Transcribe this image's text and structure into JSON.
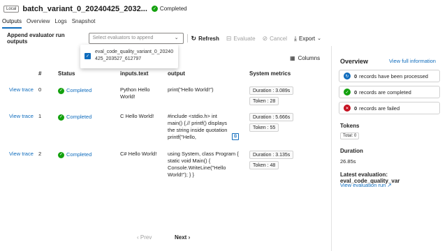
{
  "header": {
    "badge": "Local",
    "title": "batch_variant_0_20240425_2032...",
    "status": "Completed"
  },
  "tabs": [
    "Outputs",
    "Overview",
    "Logs",
    "Snapshot"
  ],
  "toolbar": {
    "append_label": "Append evaluator run outputs",
    "select_placeholder": "Select evaluators to append",
    "refresh": "Refresh",
    "evaluate": "Evaluate",
    "cancel": "Cancel",
    "export": "Export"
  },
  "dropdown": {
    "option": "eval_code_quality_variant_0_20240425_203527_612797"
  },
  "table": {
    "columns_button": "Columns",
    "headers": [
      "#",
      "Status",
      "inputs.text",
      "output",
      "System metrics"
    ],
    "rows": [
      {
        "action": "View trace",
        "index": "0",
        "status": "Completed",
        "input": "Python Hello World!",
        "output": "print(\"Hello World!\")",
        "duration": "Duration : 3.089s",
        "tokens": "Token : 28"
      },
      {
        "action": "View trace",
        "index": "1",
        "status": "Completed",
        "input": "C Hello World!",
        "output": "#include <stdio.h> int main() {,// printf() displays the string inside quotation printf(\"Hello,",
        "duration": "Duration : 5.666s",
        "tokens": "Token : 55"
      },
      {
        "action": "View trace",
        "index": "2",
        "status": "Completed",
        "input": "C# Hello World!",
        "output": "using System, class Program { static void Main() { Console.WriteLine(\"Hello World!\"); } }",
        "duration": "Duration : 3.135s",
        "tokens": "Token : 48"
      }
    ]
  },
  "pagination": {
    "prev": "Prev",
    "next": "Next"
  },
  "overview": {
    "title": "Overview",
    "full_info_link": "View full information",
    "stats": [
      {
        "count": "0",
        "text": "records have been processed",
        "color": "#0f6cbd"
      },
      {
        "count": "0",
        "text": "records are completed",
        "color": "#13a10e"
      },
      {
        "count": "0",
        "text": "records are failed",
        "color": "#c50f1f"
      }
    ],
    "tokens_label": "Tokens",
    "tokens_value": "Total: 0",
    "duration_label": "Duration",
    "duration_value": "26.85s",
    "latest_eval_label": "Latest evaluation: eval_code_quality_var",
    "eval_run_link": "View evaluation run"
  }
}
